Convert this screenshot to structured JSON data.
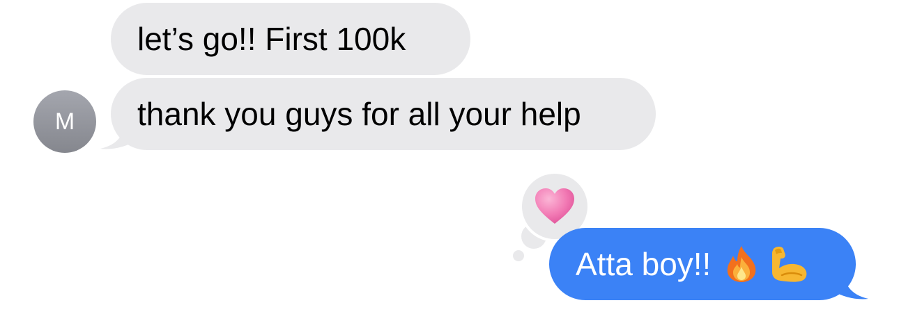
{
  "conversation": {
    "messages": [
      {
        "sender": "M",
        "direction": "incoming",
        "text": "let’s go!! First 100k"
      },
      {
        "sender": "M",
        "direction": "incoming",
        "text": "thank you guys for all your help"
      },
      {
        "sender": "me",
        "direction": "outgoing",
        "text": "Atta boy!!",
        "emojis": [
          "fire-emoji",
          "flexed-biceps-emoji"
        ],
        "reaction": "heart-icon"
      }
    ],
    "avatar_initial": "M"
  },
  "colors": {
    "incoming_bubble": "#e9e9eb",
    "outgoing_bubble": "#3b82f6",
    "avatar": "#8e9097",
    "heart": "#f27ab4"
  }
}
